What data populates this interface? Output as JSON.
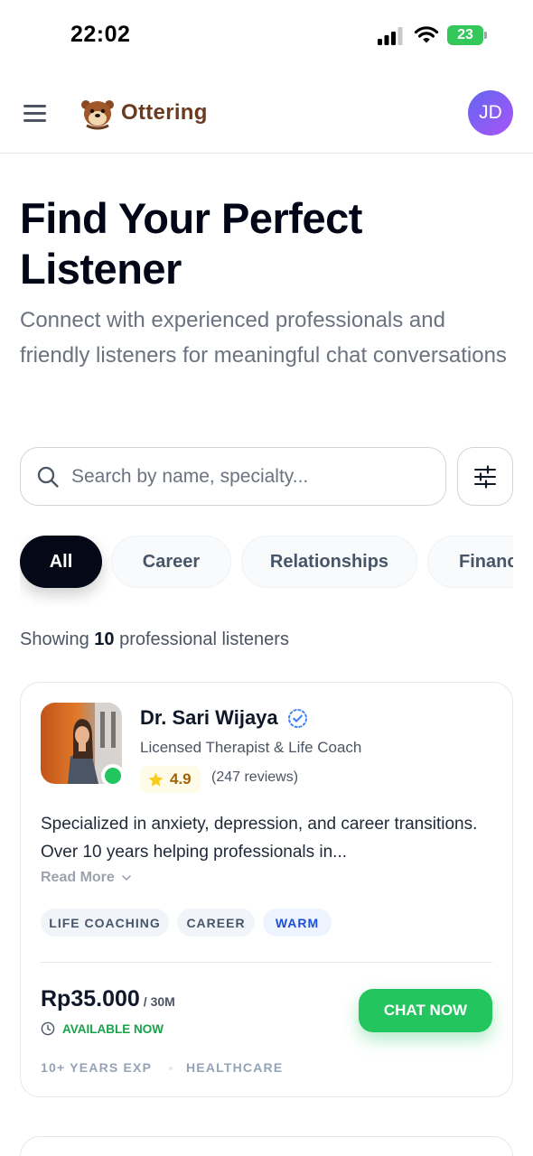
{
  "status_bar": {
    "time": "22:02",
    "battery": "23"
  },
  "header": {
    "logo_text": "Ottering",
    "avatar_initials": "JD"
  },
  "hero": {
    "title": "Find Your Perfect Listener",
    "subtitle": "Connect with experienced professionals and friendly listeners for meaningful chat conversations"
  },
  "search": {
    "placeholder": "Search by name, specialty..."
  },
  "categories": [
    {
      "label": "All",
      "active": true
    },
    {
      "label": "Career",
      "active": false
    },
    {
      "label": "Relationships",
      "active": false
    },
    {
      "label": "Finance",
      "active": false
    }
  ],
  "results": {
    "prefix": "Showing",
    "count": "10",
    "suffix": "professional listeners"
  },
  "listener": {
    "name": "Dr. Sari Wijaya",
    "role": "Licensed Therapist & Life Coach",
    "rating": "4.9",
    "reviews": "(247 reviews)",
    "bio": "Specialized in anxiety, depression, and career transitions. Over 10 years helping professionals in...",
    "read_more": "Read More",
    "tags": [
      "LIFE COACHING",
      "CAREER",
      "WARM"
    ],
    "price": "Rp35.000",
    "price_unit": "/ 30M",
    "availability": "AVAILABLE NOW",
    "chat_label": "CHAT NOW",
    "experience": "10+ YEARS EXP",
    "sector": "HEALTHCARE",
    "online": true
  },
  "colors": {
    "accent_green": "#22c55e",
    "active_chip": "#050816",
    "verified_blue": "#3b82f6",
    "logo_brown": "#6b3a1f",
    "avatar_gradient": [
      "#6366f1",
      "#a855f7"
    ]
  },
  "icons": {
    "menu": "hamburger-icon",
    "search": "search-icon",
    "filter": "sliders-icon",
    "verified": "verified-check-icon",
    "rating": "star-icon",
    "read_more": "chevron-down-icon",
    "availability": "clock-icon"
  }
}
